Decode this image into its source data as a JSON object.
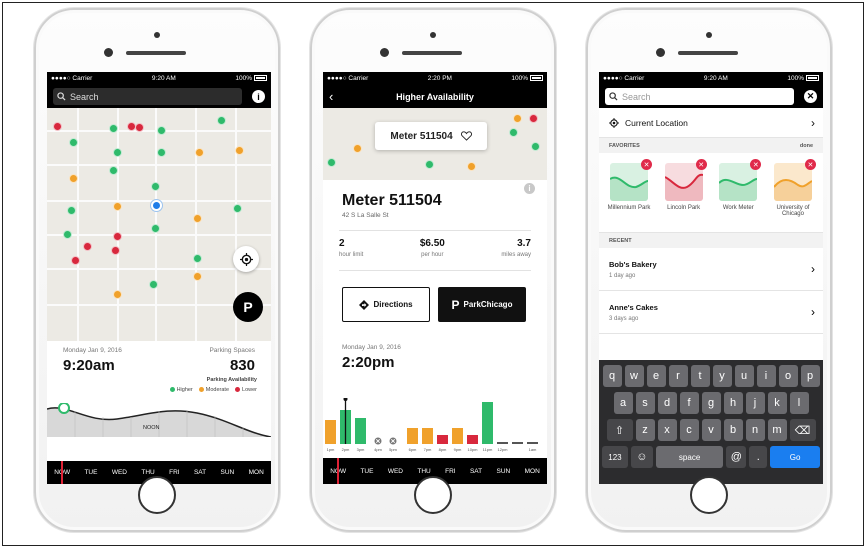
{
  "status": {
    "carrier": "●●●●○ Carrier",
    "battery": "100%",
    "times": [
      "9:20 AM",
      "2:20 PM",
      "9:20 AM"
    ]
  },
  "screen1": {
    "search_placeholder": "Search",
    "info_icon": "i",
    "date": "Monday Jan 9, 2016",
    "time": "9:20am",
    "spaces_label": "Parking Spaces",
    "spaces_value": "830",
    "availability_label": "Parking Availability",
    "legend": [
      {
        "label": "Higher",
        "color": "#2fba6b"
      },
      {
        "label": "Moderate",
        "color": "#f0a12b"
      },
      {
        "label": "Lower",
        "color": "#d8283d"
      }
    ],
    "noon_label": "NOON",
    "days": [
      "NOW",
      "TUE",
      "WED",
      "THU",
      "FRI",
      "SAT",
      "SUN",
      "MON"
    ]
  },
  "screen2": {
    "nav_title": "Higher Availability",
    "callout_title": "Meter 511504",
    "meter_title": "Meter 511504",
    "address": "42 S La Salle St",
    "stats": [
      {
        "value": "2",
        "label": "hour limit"
      },
      {
        "value": "$6.50",
        "label": "per hour"
      },
      {
        "value": "3.7",
        "label": "miles away"
      }
    ],
    "directions_label": "Directions",
    "parkchicago_label": "ParkChicago",
    "date": "Monday Jan 9, 2016",
    "time": "2:20pm",
    "hours": [
      "1pm",
      "2pm",
      "3pm",
      "4pm",
      "5pm",
      "6pm",
      "7pm",
      "8pm",
      "9pm",
      "10pm",
      "11pm",
      "12pm",
      "1am"
    ],
    "days": [
      "NOW",
      "TUE",
      "WED",
      "THU",
      "FRI",
      "SAT",
      "SUN",
      "MON"
    ]
  },
  "screen3": {
    "search_placeholder": "Search",
    "current_location": "Current Location",
    "favorites_label": "FAVORITES",
    "done_label": "done",
    "favorites": [
      {
        "name": "Millennium Park",
        "color": "#2fba6b"
      },
      {
        "name": "Lincoln Park",
        "color": "#d8283d"
      },
      {
        "name": "Work Meter",
        "color": "#2fba6b"
      },
      {
        "name": "University of Chicago",
        "color": "#f0a12b"
      }
    ],
    "recent_label": "RECENT",
    "recent": [
      {
        "name": "Bob's Bakery",
        "ago": "1 day ago"
      },
      {
        "name": "Anne's Cakes",
        "ago": "3 days ago"
      }
    ],
    "keyboard": {
      "row1": [
        "q",
        "w",
        "e",
        "r",
        "t",
        "y",
        "u",
        "i",
        "o",
        "p"
      ],
      "row2": [
        "a",
        "s",
        "d",
        "f",
        "g",
        "h",
        "j",
        "k",
        "l"
      ],
      "row3": [
        "z",
        "x",
        "c",
        "v",
        "b",
        "n",
        "m"
      ],
      "shift": "⇧",
      "delete": "⌫",
      "numbers": "123",
      "emoji": "☺",
      "space": "space",
      "at": "@",
      "dot": ".",
      "go": "Go"
    }
  }
}
